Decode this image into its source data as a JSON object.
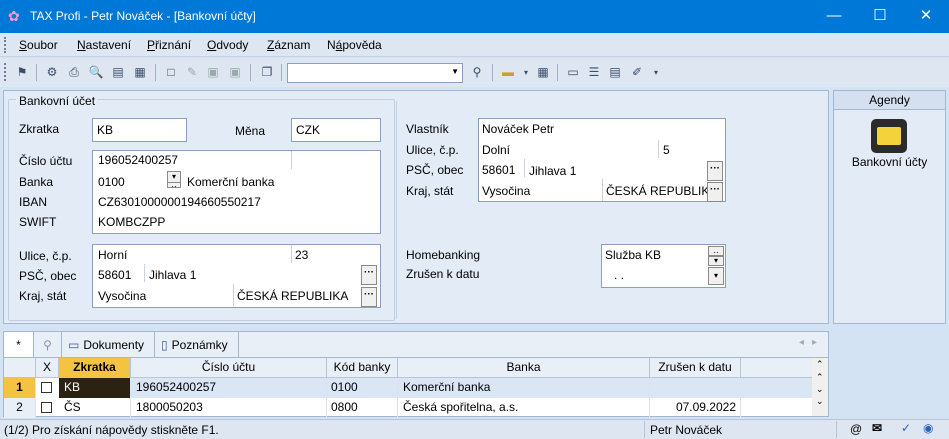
{
  "window": {
    "title": "TAX Profi - Petr Nováček - [Bankovní účty]",
    "minimize": "—",
    "maximize": "☐",
    "close": "✕"
  },
  "menu": {
    "items": [
      {
        "pre": "",
        "ul": "S",
        "post": "oubor"
      },
      {
        "pre": "",
        "ul": "N",
        "post": "astavení"
      },
      {
        "pre": "",
        "ul": "P",
        "post": "řiznání"
      },
      {
        "pre": "",
        "ul": "O",
        "post": "dvody"
      },
      {
        "pre": "",
        "ul": "Z",
        "post": "áznam"
      },
      {
        "pre": "N",
        "ul": "á",
        "post": "pověda"
      }
    ]
  },
  "form": {
    "group_label": "Bankovní účet",
    "zkratka_label": "Zkratka",
    "zkratka_value": "KB",
    "mena_label": "Měna",
    "mena_value": "CZK",
    "cislo_uctu_label": "Číslo účtu",
    "cislo_uctu_value": "196052400257",
    "banka_label": "Banka",
    "banka_code": "0100",
    "banka_name": "Komerční banka",
    "iban_label": "IBAN",
    "iban_value": "CZ6301000000194660550217",
    "swift_label": "SWIFT",
    "swift_value": "KOMBCZPP",
    "ulice_label": "Ulice, č.p.",
    "ulice_value": "Horní",
    "cp_value": "23",
    "psc_label": "PSČ, obec",
    "psc_value": "58601",
    "obec_value": "Jihlava 1",
    "kraj_label": "Kraj, stát",
    "kraj_value": "Vysočina",
    "stat_value": "ČESKÁ REPUBLIKA",
    "vlastnik_label": "Vlastník",
    "vlastnik_value": "Nováček Petr",
    "v_ulice_label": "Ulice, č.p.",
    "v_ulice_value": "Dolní",
    "v_cp_value": "5",
    "v_psc_label": "PSČ, obec",
    "v_psc_value": "58601",
    "v_obec_value": "Jihlava 1",
    "v_kraj_label": "Kraj, stát",
    "v_kraj_value": "Vysočina",
    "v_stat_value": "ČESKÁ REPUBLIKA",
    "homebanking_label": "Homebanking",
    "homebanking_value": "Služba KB",
    "zrusen_label": "Zrušen k datu",
    "zrusen_value": ". ."
  },
  "agendy": {
    "title": "Agendy",
    "item_label": "Bankovní účty"
  },
  "tabs": {
    "star": "*",
    "dokumenty": "Dokumenty",
    "poznamky": "Poznámky"
  },
  "grid": {
    "headers": [
      "X",
      "Zkratka",
      "Číslo účtu",
      "Kód banky",
      "Banka",
      "Zrušen k datu"
    ],
    "rows": [
      {
        "num": "1",
        "zkratka": "KB",
        "cislo": "196052400257",
        "kod": "0100",
        "banka": "Komerční banka",
        "zrusen": ""
      },
      {
        "num": "2",
        "zkratka": "ČS",
        "cislo": "1800050203",
        "kod": "0800",
        "banka": "Česká spořitelna, a.s.",
        "zrusen": "07.09.2022"
      }
    ]
  },
  "status": {
    "left": "(1/2)  Pro získání nápovědy stiskněte F1.",
    "user": "Petr Nováček"
  },
  "colors": {
    "titlebar": "#0078d7",
    "row_selected_marker": "#f5c342",
    "zkratka_cell": "#2a2213"
  }
}
